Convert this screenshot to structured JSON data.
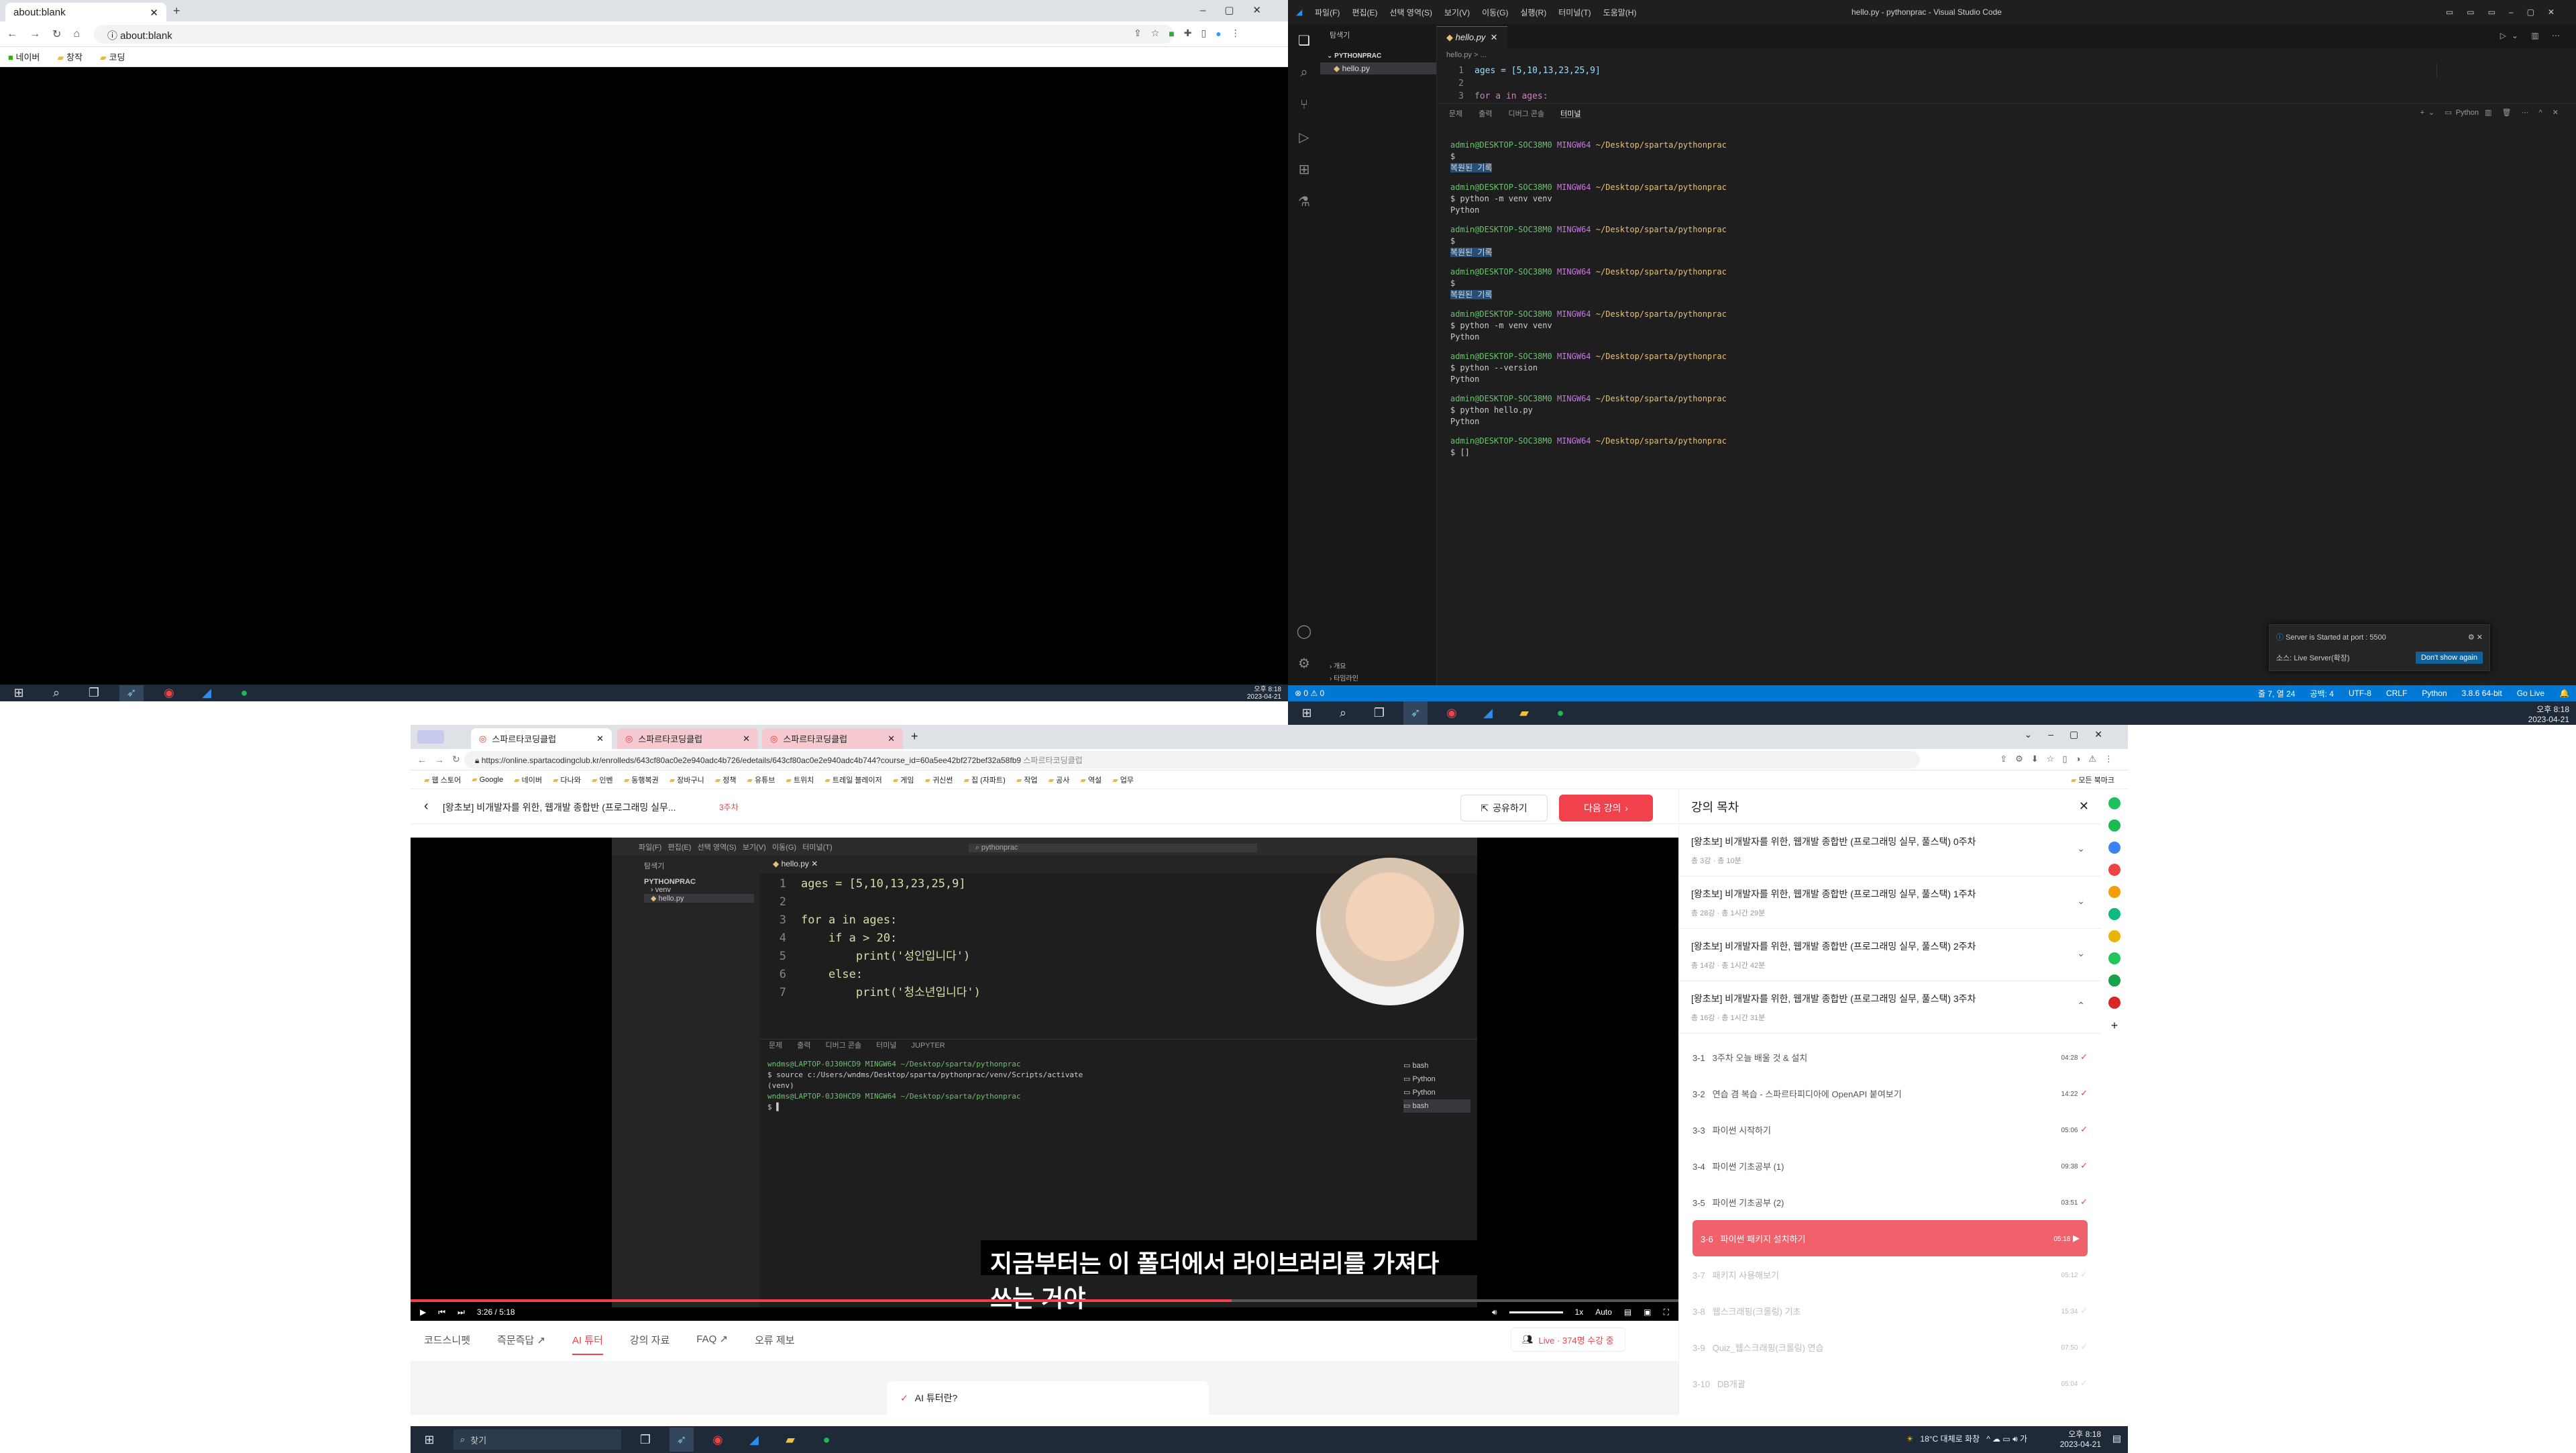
{
  "chrome_top": {
    "tab_title": "about:blank",
    "url": "about:blank",
    "bookmarks": [
      "네이버",
      "창작",
      "코딩"
    ]
  },
  "taskbar_top_left": {
    "time": "오후 8:18",
    "date": "2023-04-21"
  },
  "vscode": {
    "window_title": "hello.py - pythonprac - Visual Studio Code",
    "menu": [
      "파일(F)",
      "편집(E)",
      "선택 영역(S)",
      "보기(V)",
      "이동(G)",
      "실행(R)",
      "터미널(T)",
      "도움말(H)"
    ],
    "explorer_title": "탐색기",
    "folder": "PYTHONPRAC",
    "file": "hello.py",
    "tab": "hello.py",
    "breadcrumb": "hello.py > ...",
    "code_lines": [
      "ages = [5,10,13,23,25,9]",
      "",
      "for a in ages:"
    ],
    "panel_tabs": [
      "문제",
      "출력",
      "디버그 콘솔",
      "터미널"
    ],
    "terminal_profile": "Python",
    "terminal": [
      {
        "prompt": "admin@DESKTOP-SOC38M0",
        "env": "MINGW64",
        "path": "~/Desktop/sparta/pythonprac"
      },
      {
        "cmd": "$"
      },
      {
        "badge": "복원된 기록"
      },
      {
        "prompt": "admin@DESKTOP-SOC38M0",
        "env": "MINGW64",
        "path": "~/Desktop/sparta/pythonprac"
      },
      {
        "cmd": "$ python -m venv venv"
      },
      {
        "out": "Python"
      },
      {
        "prompt": "admin@DESKTOP-SOC38M0",
        "env": "MINGW64",
        "path": "~/Desktop/sparta/pythonprac"
      },
      {
        "cmd": "$"
      },
      {
        "badge": "복원된 기록"
      },
      {
        "prompt": "admin@DESKTOP-SOC38M0",
        "env": "MINGW64",
        "path": "~/Desktop/sparta/pythonprac"
      },
      {
        "cmd": "$"
      },
      {
        "badge": "복원된 기록"
      },
      {
        "prompt": "admin@DESKTOP-SOC38M0",
        "env": "MINGW64",
        "path": "~/Desktop/sparta/pythonprac"
      },
      {
        "cmd": "$ python -m venv venv"
      },
      {
        "out": "Python"
      },
      {
        "prompt": "admin@DESKTOP-SOC38M0",
        "env": "MINGW64",
        "path": "~/Desktop/sparta/pythonprac"
      },
      {
        "cmd": "$ python --version"
      },
      {
        "out": "Python"
      },
      {
        "prompt": "admin@DESKTOP-SOC38M0",
        "env": "MINGW64",
        "path": "~/Desktop/sparta/pythonprac"
      },
      {
        "cmd": "$ python hello.py"
      },
      {
        "out": "Python"
      },
      {
        "prompt": "admin@DESKTOP-SOC38M0",
        "env": "MINGW64",
        "path": "~/Desktop/sparta/pythonprac"
      },
      {
        "cmd": "$ []"
      }
    ],
    "notification": {
      "message": "Server is Started at port : 5500",
      "source": "소스: Live Server(확장)",
      "button": "Don't show again"
    },
    "outline_items": [
      "개요",
      "타임라인"
    ],
    "status": {
      "errors": "⊗ 0 ⚠ 0",
      "position": "줄 7, 열 24",
      "spaces": "공백: 4",
      "encoding": "UTF-8",
      "eol": "CRLF",
      "language": "Python",
      "interpreter": "3.8.6 64-bit",
      "golive": "Go Live"
    },
    "time": "오후 8:18",
    "date": "2023-04-21"
  },
  "chrome_bottom": {
    "tabs": [
      "스파르타코딩클럽",
      "스파르타코딩클럽",
      "스파르타코딩클럽"
    ],
    "url": "https://online.spartacodingclub.kr/enrolleds/643cf80ac0e2e940adc4b726/edetails/643cf80ac0e2e940adc4b744?course_id=60a5ee42bf272bef32a58fb9",
    "url_suffix": "스파르타코딩클럽",
    "bookmarks": [
      "웹 스토어",
      "Google",
      "네이버",
      "다나와",
      "인벤",
      "동행복권",
      "장바구니",
      "정책",
      "유튜브",
      "트위치",
      "트레일 블레이저",
      "게임",
      "귀신썬",
      "집 (자파트)",
      "작업",
      "공사",
      "역설",
      "업무"
    ],
    "bookmarks_right": "모든 북마크",
    "course_title": "[왕초보] 비개발자를 위한, 웹개발 종합반 (프로그래밍 실무...",
    "week": "3주차",
    "share": "공유하기",
    "next": "다음 강의",
    "subtitle": "지금부터는 이 폴더에서 라이브러리를 가져다 쓰는 거야",
    "video_time": "3:26",
    "video_duration": "5:18",
    "speed": "1x",
    "quality": "Auto",
    "video_code": [
      "ages = [5,10,13,23,25,9]",
      "",
      "for a in ages:",
      "    if a > 20:",
      "        print('성인입니다')",
      "    else:",
      "        print('청소년입니다')"
    ],
    "video_terminal": [
      "wndms@LAPTOP-0J30HCD9 MINGW64 ~/Desktop/sparta/pythonprac",
      "$ source c:/Users/wndms/Desktop/sparta/pythonprac/venv/Scripts/activate",
      "(venv)",
      "wndms@LAPTOP-0J30HCD9 MINGW64 ~/Desktop/sparta/pythonprac",
      "$ ▌"
    ],
    "video_panel_tabs": [
      "문제",
      "출력",
      "디버그 콘솔",
      "터미널",
      "JUPYTER"
    ],
    "video_shells": [
      "bash",
      "Python",
      "Python",
      "bash"
    ],
    "video_explorer": [
      "PYTHONPRAC",
      "venv",
      "hello.py"
    ],
    "subnav": [
      "코드스니펫",
      "즉문즉답",
      "AI 튜터",
      "강의 자료",
      "FAQ",
      "오류 제보"
    ],
    "ai_tutor": "AI 튜터란?",
    "live": "Live · 374명 수강 중",
    "toc_title": "강의 목차",
    "sections": [
      {
        "title": "[왕초보] 비개발자를 위한, 웹개발 종합반 (프로그래밍 실무, 풀스택) 0주차",
        "meta": "총 3강 · 총 10분"
      },
      {
        "title": "[왕초보] 비개발자를 위한, 웹개발 종합반 (프로그래밍 실무, 풀스택) 1주차",
        "meta": "총 28강 · 총 1시간 29분"
      },
      {
        "title": "[왕초보] 비개발자를 위한, 웹개발 종합반 (프로그래밍 실무, 풀스택) 2주차",
        "meta": "총 14강 · 총 1시간 42분"
      },
      {
        "title": "[왕초보] 비개발자를 위한, 웹개발 종합반 (프로그래밍 실무, 풀스택) 3주차",
        "meta": "총 16강 · 총 1시간 31분"
      }
    ],
    "lessons": [
      {
        "num": "3-1",
        "title": "3주차 오늘 배울 것 & 설치",
        "dur": "04:28"
      },
      {
        "num": "3-2",
        "title": "연습 겸 복습 - 스파르타피디아에 OpenAPI 붙여보기",
        "dur": "14:22"
      },
      {
        "num": "3-3",
        "title": "파이썬 시작하기",
        "dur": "05:06"
      },
      {
        "num": "3-4",
        "title": "파이썬 기초공부 (1)",
        "dur": "09:38"
      },
      {
        "num": "3-5",
        "title": "파이썬 기초공부 (2)",
        "dur": "03:51"
      },
      {
        "num": "3-6",
        "title": "파이썬 패키지 설치하기",
        "dur": "05:18"
      },
      {
        "num": "3-7",
        "title": "패키지 사용해보기",
        "dur": "05:12"
      },
      {
        "num": "3-8",
        "title": "웹스크래핑(크롤링) 기초",
        "dur": "15:34"
      },
      {
        "num": "3-9",
        "title": "Quiz_웹스크래핑(크롤링) 연습",
        "dur": "07:50"
      },
      {
        "num": "3-10",
        "title": "DB개괄",
        "dur": "05:04"
      }
    ],
    "accent": "#f0414c"
  },
  "taskbar_bottom": {
    "search": "찾기",
    "weather": "18°C 대체로 화창",
    "time": "오후 8:18",
    "date": "2023-04-21"
  }
}
